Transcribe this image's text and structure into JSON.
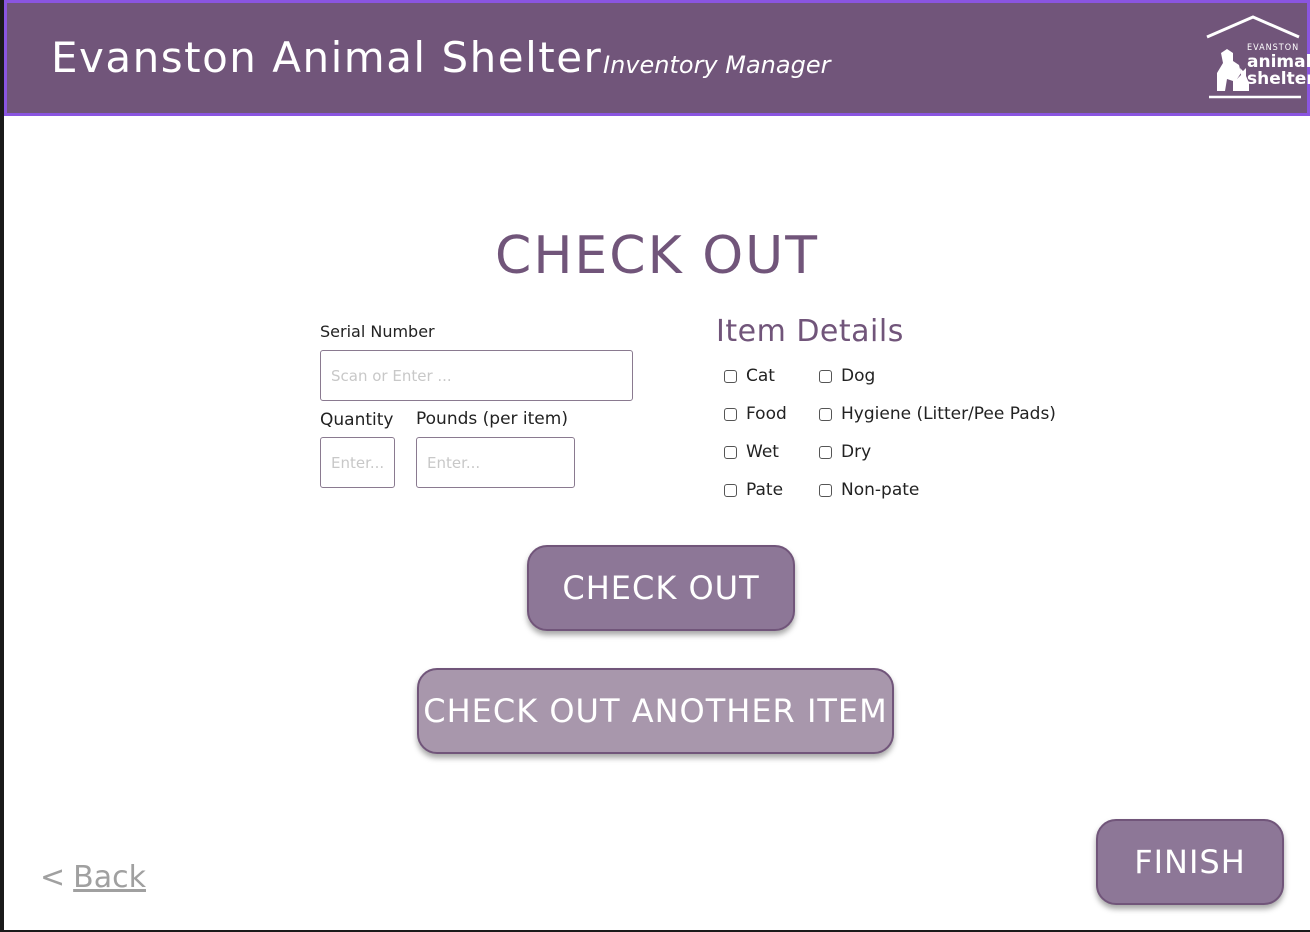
{
  "header": {
    "title": "Evanston Animal Shelter",
    "subtitle": "Inventory Manager",
    "logo": {
      "top_text": "EVANSTON",
      "line1": "animal",
      "line2": "shelter",
      "icon": "house-dog-cat-logo"
    }
  },
  "main": {
    "title": "CHECK OUT",
    "serial": {
      "label": "Serial Number",
      "placeholder": "Scan or Enter ..."
    },
    "quantity": {
      "label": "Quantity",
      "placeholder": "Enter..."
    },
    "pounds": {
      "label": "Pounds (per item)",
      "placeholder": "Enter..."
    },
    "item_details": {
      "title": "Item Details",
      "options": [
        "Cat",
        "Dog",
        "Food",
        "Hygiene (Litter/Pee Pads)",
        "Wet",
        "Dry",
        "Pate",
        "Non-pate"
      ]
    },
    "checkout_button": "CHECK OUT",
    "another_button": "CHECK OUT ANOTHER ITEM"
  },
  "footer": {
    "back_chevron": "<",
    "back_label": "Back",
    "finish_button": "FINISH"
  },
  "colors": {
    "brand": "#71557a",
    "header_border": "#8a55e0",
    "button_primary": "#8d7797",
    "button_secondary": "#a897ac"
  }
}
